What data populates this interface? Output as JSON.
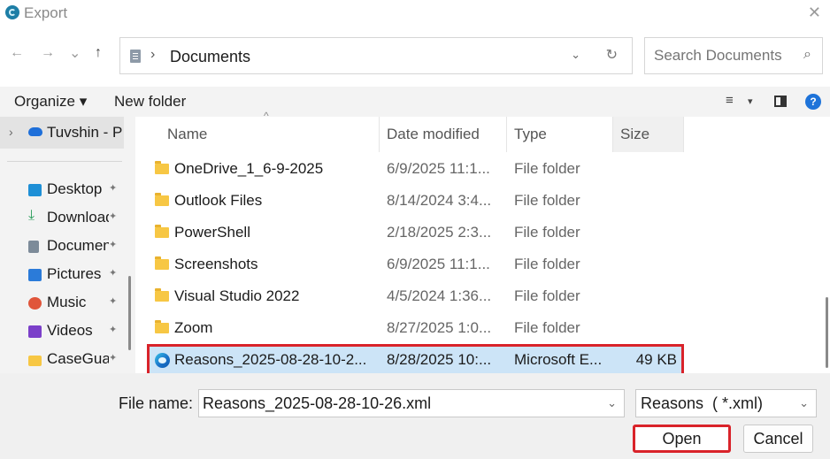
{
  "window": {
    "title": "Export",
    "close": "✕"
  },
  "nav": {
    "back": "←",
    "forward": "→",
    "recent": "⌄",
    "up": "↑"
  },
  "address": {
    "sep": "›",
    "crumb": "Documents",
    "dropdown": "⌄",
    "refresh": "↻"
  },
  "search": {
    "placeholder": "Search Documents",
    "icon": "⌕"
  },
  "toolbar": {
    "organize": "Organize ▾",
    "new_folder": "New folder",
    "view_icon": "≡",
    "view_dd": "▾",
    "help": "?"
  },
  "sidebar": {
    "top": {
      "chevron": "›",
      "label": "Tuvshin - P"
    },
    "items": [
      {
        "label": "Desktop",
        "icon": "desktop-icon",
        "color": "#1e8fd6",
        "pin": "📌"
      },
      {
        "label": "Downloads",
        "icon": "download-icon",
        "color": "#2a9d5a",
        "pin": "📌"
      },
      {
        "label": "Documents",
        "icon": "document-icon",
        "color": "#7d8b99",
        "pin": "📌"
      },
      {
        "label": "Pictures",
        "icon": "pictures-icon",
        "color": "#2b7bd9",
        "pin": "📌"
      },
      {
        "label": "Music",
        "icon": "music-icon",
        "color": "#e0553a",
        "pin": "📌"
      },
      {
        "label": "Videos",
        "icon": "videos-icon",
        "color": "#7b3fc9",
        "pin": "📌"
      },
      {
        "label": "CaseGuard",
        "icon": "folder-icon",
        "color": "#f7c744",
        "pin": "📌"
      }
    ]
  },
  "columns": {
    "name": "Name",
    "date": "Date modified",
    "type": "Type",
    "size": "Size",
    "sort_caret": "^"
  },
  "files": [
    {
      "name": "OneDrive_1_6-9-2025",
      "date": "6/9/2025 11:1...",
      "type": "File folder",
      "size": "",
      "icon": "folder-icon"
    },
    {
      "name": "Outlook Files",
      "date": "8/14/2024 3:4...",
      "type": "File folder",
      "size": "",
      "icon": "folder-icon"
    },
    {
      "name": "PowerShell",
      "date": "2/18/2025 2:3...",
      "type": "File folder",
      "size": "",
      "icon": "folder-icon"
    },
    {
      "name": "Screenshots",
      "date": "6/9/2025 11:1...",
      "type": "File folder",
      "size": "",
      "icon": "folder-icon"
    },
    {
      "name": "Visual Studio 2022",
      "date": "4/5/2024 1:36...",
      "type": "File folder",
      "size": "",
      "icon": "folder-icon"
    },
    {
      "name": "Zoom",
      "date": "8/27/2025 1:0...",
      "type": "File folder",
      "size": "",
      "icon": "folder-icon"
    },
    {
      "name": "Reasons_2025-08-28-10-2...",
      "date": "8/28/2025 10:...",
      "type": "Microsoft E...",
      "size": "49 KB",
      "icon": "edge-icon",
      "selected": true
    }
  ],
  "footer": {
    "file_name_label": "File name:",
    "file_name_value": "Reasons_2025-08-28-10-26.xml",
    "file_type": "Reasons  ( *.xml)",
    "open": "Open",
    "cancel": "Cancel",
    "dropdown": "⌄"
  },
  "colors": {
    "accent": "#1e73d9",
    "highlight_border": "#d9232a",
    "selection": "#cce4f7"
  }
}
